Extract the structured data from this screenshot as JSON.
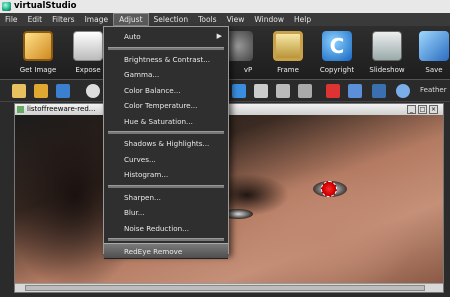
{
  "window": {
    "title": "virtualStudio"
  },
  "menubar": {
    "items": [
      "File",
      "Edit",
      "Filters",
      "Image",
      "Adjust",
      "Selection",
      "Tools",
      "View",
      "Window",
      "Help"
    ],
    "active": "Adjust"
  },
  "toolbar": {
    "tools": [
      {
        "label": "Get Image",
        "icon": "get-image-icon"
      },
      {
        "label": "Expose",
        "icon": "expose-icon"
      },
      {
        "label": "vP",
        "icon": "vp-icon"
      },
      {
        "label": "Frame",
        "icon": "frame-icon"
      },
      {
        "label": "Copyright",
        "icon": "copyright-icon",
        "glyph": "C"
      },
      {
        "label": "Slideshow",
        "icon": "slideshow-icon"
      },
      {
        "label": "Save",
        "icon": "save-icon"
      }
    ]
  },
  "toolbar2": {
    "feather_label": "Feather"
  },
  "document": {
    "title": "listoffreeware-red..."
  },
  "adjust_menu": {
    "items": [
      {
        "label": "Auto",
        "submenu": true
      },
      {
        "separator": true
      },
      {
        "label": "Brightness & Contrast..."
      },
      {
        "label": "Gamma..."
      },
      {
        "label": "Color Balance..."
      },
      {
        "label": "Color Temperature..."
      },
      {
        "label": "Hue & Saturation..."
      },
      {
        "separator": true
      },
      {
        "label": "Shadows & Highlights..."
      },
      {
        "label": "Curves..."
      },
      {
        "label": "Histogram..."
      },
      {
        "separator": true
      },
      {
        "label": "Sharpen..."
      },
      {
        "label": "Blur..."
      },
      {
        "label": "Noise Reduction..."
      },
      {
        "separator": true
      },
      {
        "label": "RedEye Remove",
        "highlighted": true
      }
    ]
  },
  "colors": {
    "menu_bg": "#2f2f2f",
    "highlight": "#5e5e5e",
    "redeye": "#e00000"
  }
}
